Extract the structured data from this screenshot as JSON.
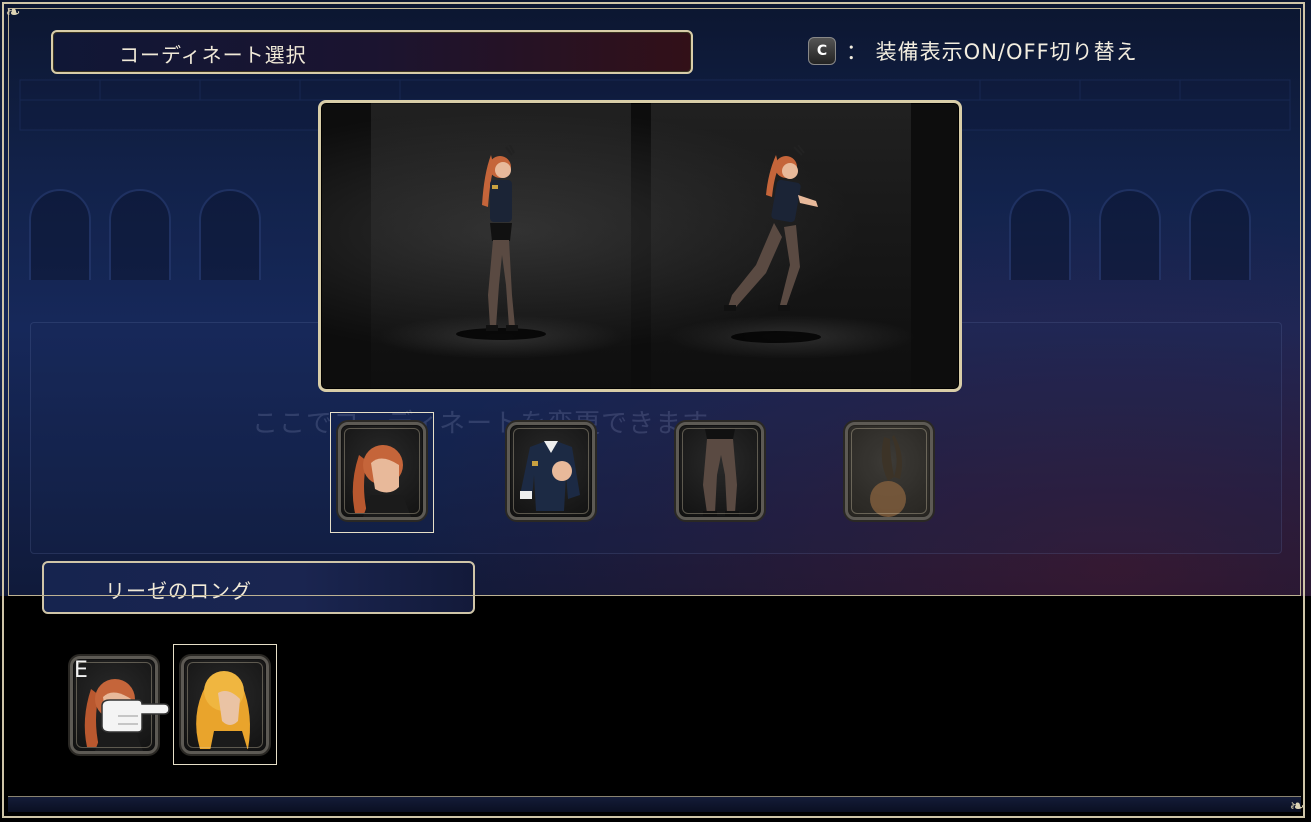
{
  "screen": {
    "title": "コーディネート選択",
    "hint_key": "C",
    "hint_text": "：  装備表示ON/OFF切り替え",
    "description": "ここでコーディネートを変更できます",
    "selected_name": "リーゼのロング",
    "equipped_badge": "E"
  },
  "equipment_slots": [
    {
      "name": "hair",
      "icon": "hair-icon",
      "selected": true
    },
    {
      "name": "outfit",
      "icon": "jacket-icon",
      "selected": false
    },
    {
      "name": "legs",
      "icon": "stockings-icon",
      "selected": false
    },
    {
      "name": "accessory",
      "icon": "bunny-ears-icon",
      "selected": false
    }
  ],
  "hair_options": [
    {
      "icon": "long-ponytail-hair-icon",
      "equipped": true,
      "cursor": true
    },
    {
      "icon": "blonde-long-hair-icon",
      "equipped": false,
      "selected": true
    }
  ],
  "colors": {
    "frame": "#d8cda8",
    "panel_bg": "#16285a",
    "hair_orange": "#c5653a",
    "hair_blonde": "#e9a42c"
  }
}
